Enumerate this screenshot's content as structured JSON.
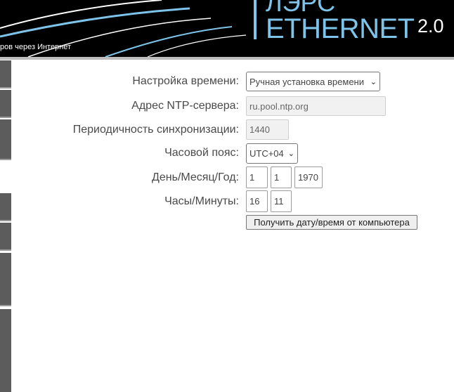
{
  "header": {
    "tagline": "ров через Интернет",
    "logo_top": "ЛЭРС",
    "logo_main": "ETHERNET",
    "logo_version": "2.0"
  },
  "colors": {
    "accent": "#7ec3ea",
    "header_bg": "#000000",
    "sidebar_tab": "#5c5c5c"
  },
  "form": {
    "time_setting": {
      "label": "Настройка времени:",
      "value": "Ручная установка времени"
    },
    "ntp_server": {
      "label": "Адрес NTP-сервера:",
      "value": "ru.pool.ntp.org"
    },
    "sync_period": {
      "label": "Периодичность синхронизации:",
      "value": "1440"
    },
    "timezone": {
      "label": "Часовой пояс:",
      "value": "UTC+04"
    },
    "date": {
      "label": "День/Месяц/Год:",
      "day": "1",
      "month": "1",
      "year": "1970"
    },
    "time": {
      "label": "Часы/Минуты:",
      "hours": "16",
      "minutes": "11"
    },
    "get_time_button": "Получить дату/время от компьютера"
  }
}
